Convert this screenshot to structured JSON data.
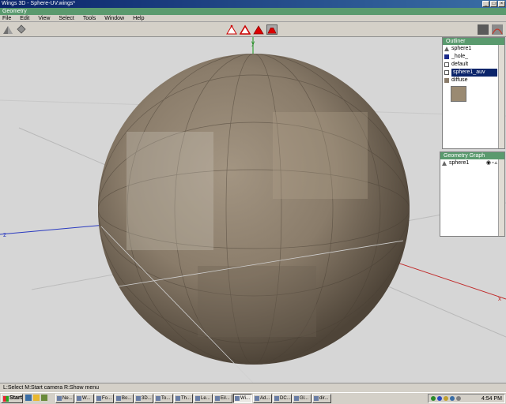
{
  "window": {
    "title": "Wings 3D - Sphere-UV.wings*",
    "mode_bar": "Geometry"
  },
  "menu": [
    "File",
    "Edit",
    "View",
    "Select",
    "Tools",
    "Window",
    "Help"
  ],
  "outliner": {
    "title": "Outliner",
    "items": [
      {
        "label": "sphere1",
        "icon": "object-icon"
      },
      {
        "label": "_hole_",
        "icon": "material-icon"
      },
      {
        "label": "default",
        "icon": "material-icon"
      },
      {
        "label": "sphere1_auv",
        "icon": "material-icon",
        "selected": true
      },
      {
        "label": "diffuse",
        "icon": "texture-icon"
      }
    ]
  },
  "geometry_graph": {
    "title": "Geometry Graph",
    "items": [
      {
        "label": "sphere1"
      }
    ]
  },
  "axes": {
    "x": "x",
    "y": "y",
    "z": "z"
  },
  "status": "L:Select   M:Start camera   R:Show menu",
  "taskbar": {
    "start": "Start",
    "tasks": [
      "Ne...",
      "W...",
      "Fo...",
      "Bo...",
      "3D...",
      "To...",
      "Th...",
      "Le...",
      "Eil...",
      "Wi...",
      "Ad...",
      "DC...",
      "Gl...",
      "dir..."
    ],
    "active_index": 9,
    "clock": "4:54 PM"
  },
  "colors": {
    "mode_bar": "#5a9a6e",
    "selection": "#0a246a",
    "viewport_bg": "#d6d6d6"
  }
}
